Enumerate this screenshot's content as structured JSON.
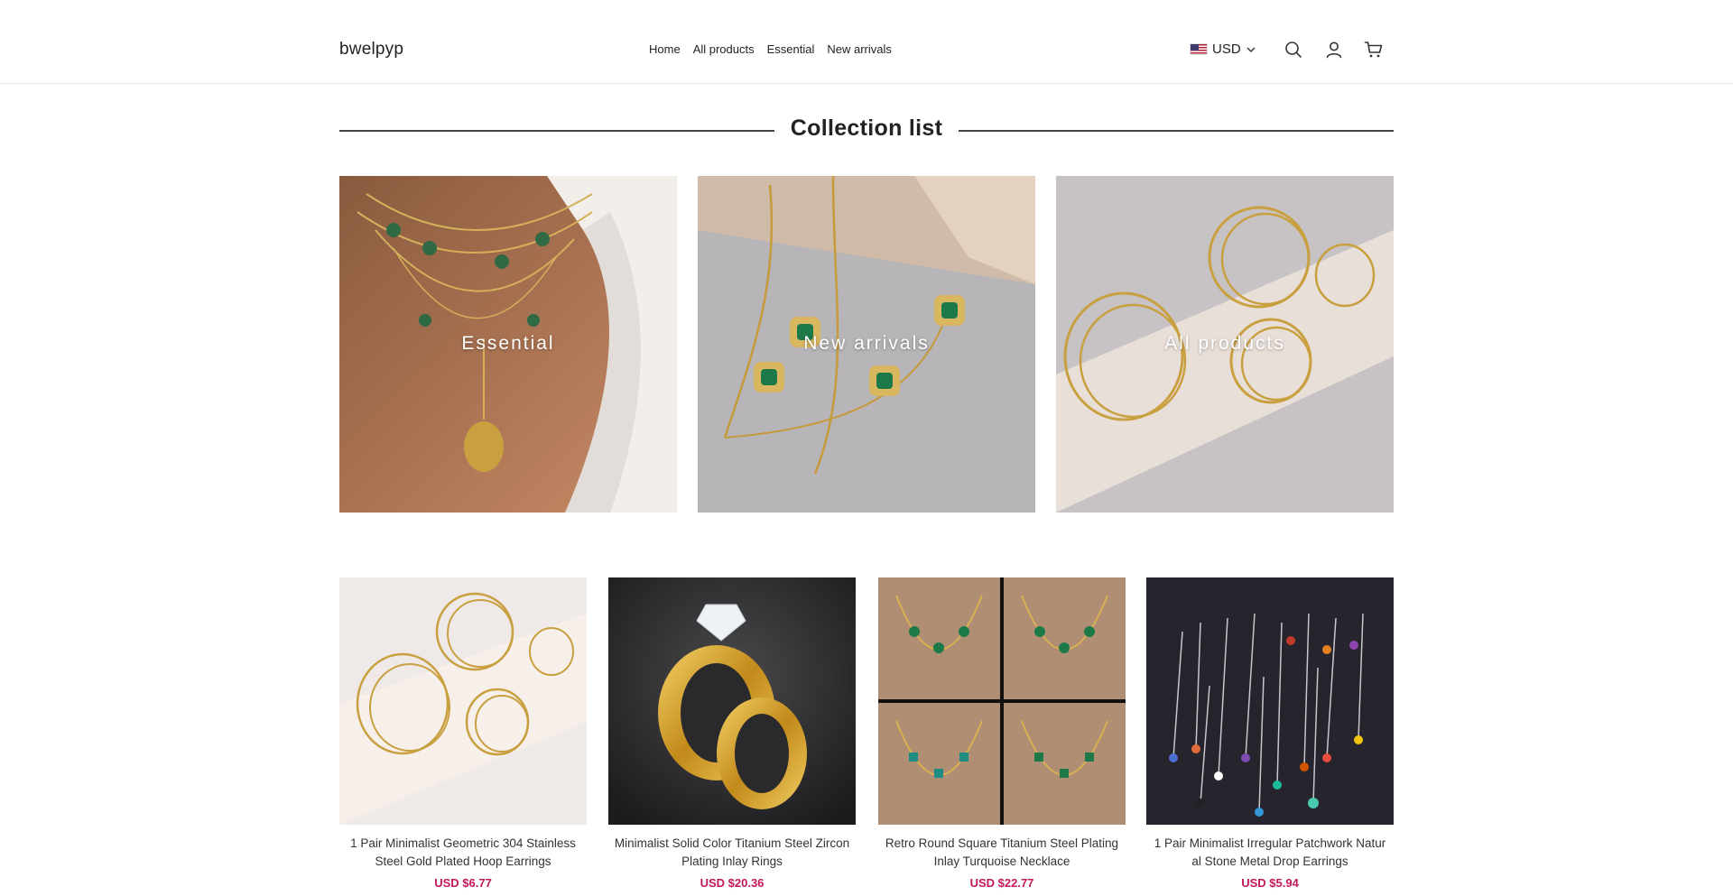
{
  "header": {
    "logo": "bwelpyp",
    "nav": [
      "Home",
      "All products",
      "Essential",
      "New arrivals"
    ],
    "currency": "USD",
    "icons": [
      "search-icon",
      "account-icon",
      "cart-icon"
    ]
  },
  "collection": {
    "title": "Collection list",
    "tiles": [
      {
        "label": "Essential"
      },
      {
        "label": "New arrivals"
      },
      {
        "label": "All products"
      }
    ]
  },
  "products": [
    {
      "title": "1 Pair Minimalist Geometric 304 Stainless Steel Gold Plated Hoop Earrings",
      "price": "USD $6.77"
    },
    {
      "title": "Minimalist Solid Color Titanium Steel Zircon Plating Inlay Rings",
      "price": "USD $20.36"
    },
    {
      "title": "Retro Round Square Titanium Steel Plating Inlay Turquoise Necklace",
      "price": "USD $22.77"
    },
    {
      "title": "1 Pair Minimalist Irregular Patchwork Natural Stone Metal Drop Earrings",
      "price": "USD $5.94"
    }
  ],
  "colors": {
    "price": "#c2185b",
    "text": "#222222"
  }
}
